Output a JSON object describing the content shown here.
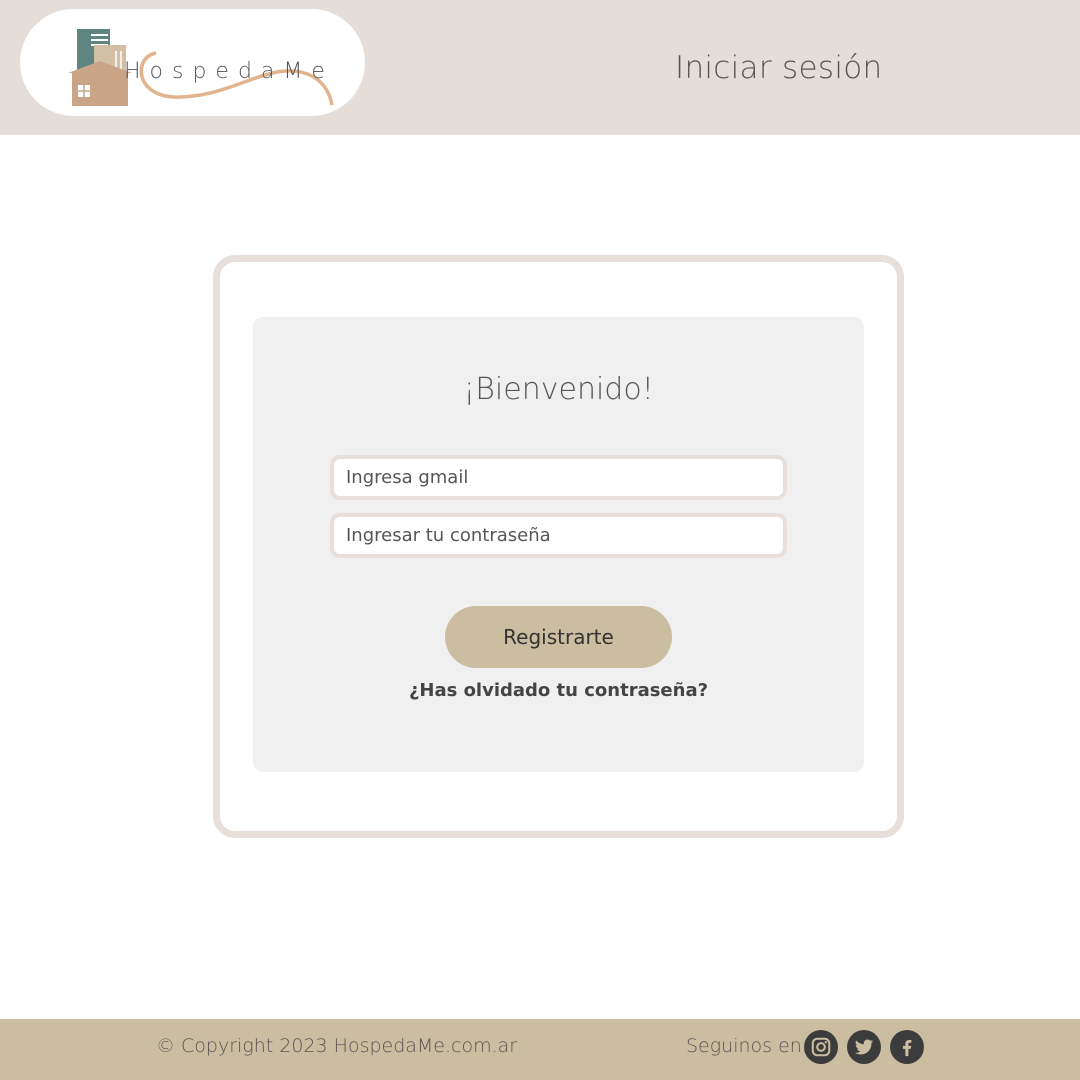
{
  "brand": {
    "logo_text": "HospedaMe",
    "logo_icon": "house-building-logo"
  },
  "header": {
    "title": "Iniciar sesión"
  },
  "login": {
    "welcome": "¡Bienvenido!",
    "email_placeholder": "Ingresa gmail",
    "email_value": "",
    "password_placeholder": "Ingresar tu contraseña",
    "password_value": "",
    "submit_label": "Registrarte",
    "forgot_label": "¿Has olvidado tu contraseña?"
  },
  "footer": {
    "copyright": "© Copyright 2023 HospedaMe.com.ar",
    "follow_label": "Seguinos en:",
    "social": [
      "instagram-icon",
      "twitter-icon",
      "facebook-icon"
    ]
  },
  "colors": {
    "header_bg": "#e5ddd8",
    "footer_bg": "#cbbd9f",
    "button_bg": "#cbbd9f",
    "card_border": "#e8dfdb",
    "card_inner_bg": "#f0f0f0",
    "logo_teal": "#5f8580",
    "logo_tan": "#c9a487",
    "logo_swoosh": "#e2b48e"
  }
}
